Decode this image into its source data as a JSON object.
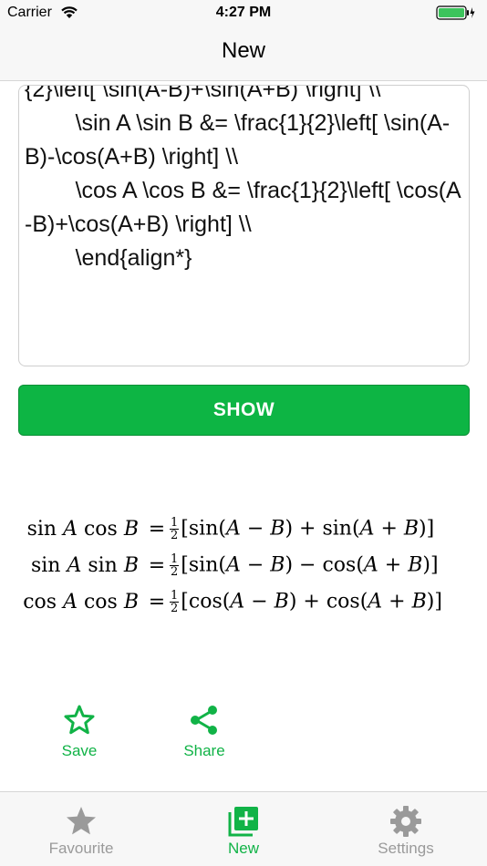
{
  "status_bar": {
    "carrier": "Carrier",
    "time": "4:27 PM"
  },
  "nav": {
    "title": "New"
  },
  "editor": {
    "text": "{2}\\left[ \\sin(A-B)+\\sin(A+B) \\right] \\\\\n        \\sin A \\sin B &= \\frac{1}{2}\\left[ \\sin(A-B)-\\cos(A+B) \\right] \\\\\n        \\cos A \\cos B &= \\frac{1}{2}\\left[ \\cos(A-B)+\\cos(A+B) \\right] \\\\\n        \\end{align*}"
  },
  "show_button": {
    "label": "SHOW"
  },
  "rendered_math": {
    "rows": [
      {
        "lhs_a": "sin",
        "lhs_av": "A",
        "lhs_b": "cos",
        "lhs_bv": "B",
        "f1": "sin",
        "op": "+",
        "f2": "sin"
      },
      {
        "lhs_a": "sin",
        "lhs_av": "A",
        "lhs_b": "sin",
        "lhs_bv": "B",
        "f1": "sin",
        "op": "−",
        "f2": "cos"
      },
      {
        "lhs_a": "cos",
        "lhs_av": "A",
        "lhs_b": "cos",
        "lhs_bv": "B",
        "f1": "cos",
        "op": "+",
        "f2": "cos"
      }
    ]
  },
  "actions": {
    "save_label": "Save",
    "share_label": "Share"
  },
  "tabs": [
    {
      "label": "Favourite",
      "icon": "star-icon",
      "active": false
    },
    {
      "label": "New",
      "icon": "add-note-icon",
      "active": true
    },
    {
      "label": "Settings",
      "icon": "gear-icon",
      "active": false
    }
  ],
  "colors": {
    "accent": "#11b347",
    "button": "#0db544",
    "tab_inactive": "#9a9a9a"
  }
}
